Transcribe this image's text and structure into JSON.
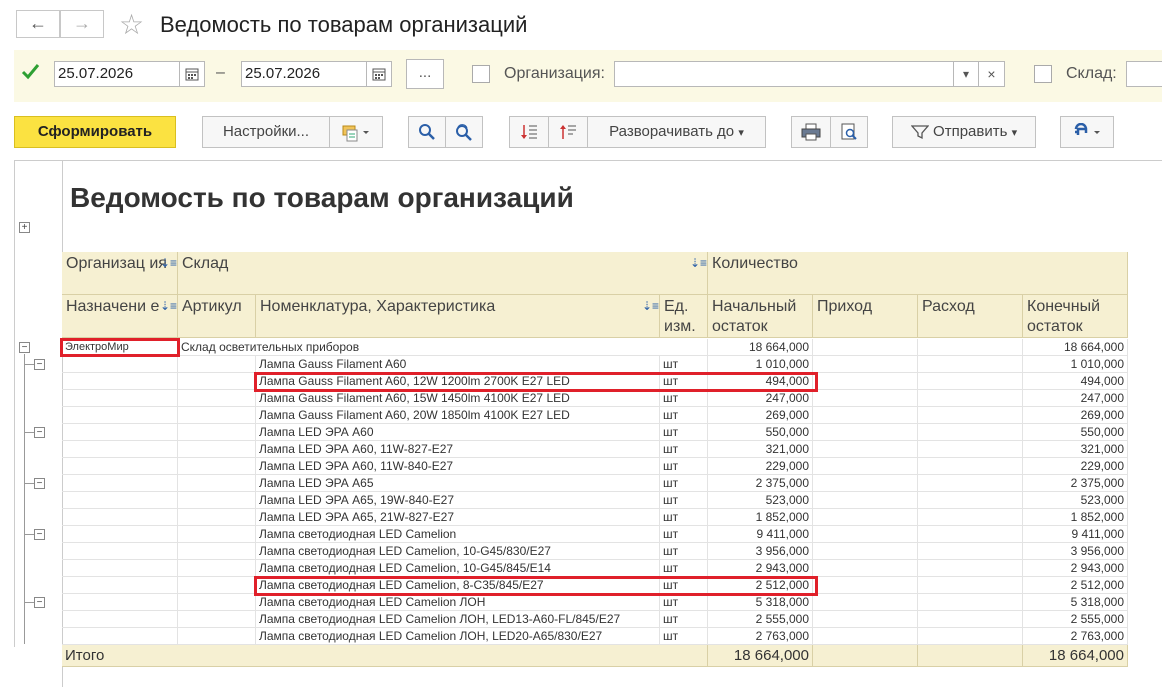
{
  "window": {
    "title": "Ведомость по товарам организаций",
    "back": "←",
    "forward": "→",
    "star": "☆"
  },
  "params": {
    "period_enabled": true,
    "date_from": "25.07.2026",
    "dash": "–",
    "date_to": "25.07.2026",
    "more_label": "...",
    "org_label": "Организация:",
    "org_value": "",
    "sklad_label": "Склад:",
    "sklad_value": ""
  },
  "toolbar": {
    "generate": "Сформировать",
    "settings": "Настройки...",
    "expand_to": "Разворачивать до",
    "send": "Отправить"
  },
  "report": {
    "title": "Ведомость по товарам организаций",
    "headers": {
      "org": "Организац ия",
      "sklad": "Склад",
      "qty": "Количество",
      "purpose": "Назначени е",
      "article": "Артикул",
      "nomenclature": "Номенклатура, Характеристика",
      "unit": "Ед. изм.",
      "start": "Начальный остаток",
      "income": "Приход",
      "expense": "Расход",
      "end": "Конечный остаток"
    },
    "org_row": {
      "org": "ЭлектроМир",
      "sklad": "Склад осветительных приборов",
      "start": "18 664,000",
      "end": "18 664,000"
    },
    "rows": [
      {
        "name": "Лампа Gauss Filament A60",
        "unit": "шт",
        "start": "1 010,000",
        "end": "1 010,000",
        "group": true
      },
      {
        "name": "Лампа Gauss Filament A60, 12W 1200lm 2700K E27 LED",
        "unit": "шт",
        "start": "494,000",
        "end": "494,000"
      },
      {
        "name": "Лампа Gauss Filament A60, 15W 1450lm 4100K E27 LED",
        "unit": "шт",
        "start": "247,000",
        "end": "247,000"
      },
      {
        "name": "Лампа Gauss Filament A60, 20W 1850lm 4100K E27 LED",
        "unit": "шт",
        "start": "269,000",
        "end": "269,000"
      },
      {
        "name": "Лампа LED ЭРА A60",
        "unit": "шт",
        "start": "550,000",
        "end": "550,000",
        "group": true
      },
      {
        "name": "Лампа LED ЭРА A60, 11W-827-E27",
        "unit": "шт",
        "start": "321,000",
        "end": "321,000"
      },
      {
        "name": "Лампа LED ЭРА A60, 11W-840-E27",
        "unit": "шт",
        "start": "229,000",
        "end": "229,000"
      },
      {
        "name": "Лампа LED ЭРА A65",
        "unit": "шт",
        "start": "2 375,000",
        "end": "2 375,000",
        "group": true
      },
      {
        "name": "Лампа LED ЭРА A65, 19W-840-E27",
        "unit": "шт",
        "start": "523,000",
        "end": "523,000"
      },
      {
        "name": "Лампа LED ЭРА A65, 21W-827-E27",
        "unit": "шт",
        "start": "1 852,000",
        "end": "1 852,000"
      },
      {
        "name": "Лампа светодиодная LED Camelion",
        "unit": "шт",
        "start": "9 411,000",
        "end": "9 411,000",
        "group": true
      },
      {
        "name": "Лампа светодиодная LED Camelion, 10-G45/830/E27",
        "unit": "шт",
        "start": "3 956,000",
        "end": "3 956,000"
      },
      {
        "name": "Лампа светодиодная LED Camelion, 10-G45/845/E14",
        "unit": "шт",
        "start": "2 943,000",
        "end": "2 943,000"
      },
      {
        "name": "Лампа светодиодная LED Camelion, 8-C35/845/E27",
        "unit": "шт",
        "start": "2 512,000",
        "end": "2 512,000"
      },
      {
        "name": "Лампа светодиодная LED Camelion ЛОН",
        "unit": "шт",
        "start": "5 318,000",
        "end": "5 318,000",
        "group": true
      },
      {
        "name": "Лампа светодиодная LED Camelion ЛОН, LED13-A60-FL/845/E27",
        "unit": "шт",
        "start": "2 555,000",
        "end": "2 555,000"
      },
      {
        "name": "Лампа светодиодная LED Camelion ЛОН, LED20-A65/830/E27",
        "unit": "шт",
        "start": "2 763,000",
        "end": "2 763,000"
      }
    ],
    "total": {
      "label": "Итого",
      "start": "18 664,000",
      "end": "18 664,000"
    }
  }
}
